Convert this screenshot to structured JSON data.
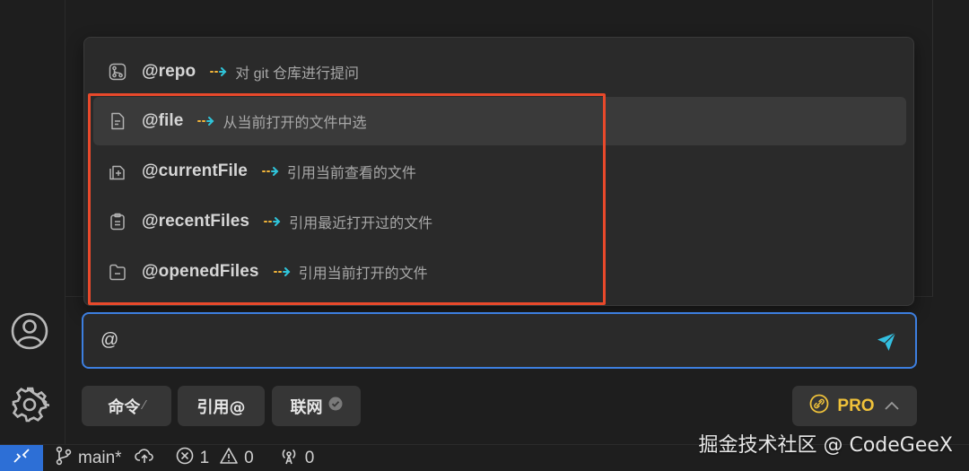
{
  "colors": {
    "accent": "#3d7fe0",
    "highlight_border": "#e8492b",
    "pro": "#f0c23a",
    "remote": "#2d6fd6"
  },
  "popup": {
    "items": [
      {
        "icon": "git-repo-icon",
        "name": "@repo",
        "desc": "对 git 仓库进行提问"
      },
      {
        "icon": "file-icon",
        "name": "@file",
        "desc": "从当前打开的文件中选"
      },
      {
        "icon": "current-file-icon",
        "name": "@currentFile",
        "desc": "引用当前查看的文件"
      },
      {
        "icon": "recent-files-icon",
        "name": "@recentFiles",
        "desc": "引用最近打开过的文件"
      },
      {
        "icon": "opened-files-icon",
        "name": "@openedFiles",
        "desc": "引用当前打开的文件"
      }
    ]
  },
  "input": {
    "value": "@"
  },
  "buttons": {
    "command": "命令",
    "command_hint": "⁄",
    "reference": "引用@",
    "web": "联网",
    "pro": "PRO"
  },
  "status": {
    "branch": "main*",
    "errors": "1",
    "warnings": "0",
    "ports": "0"
  },
  "watermark": "掘金技术社区 @ CodeGeeX"
}
